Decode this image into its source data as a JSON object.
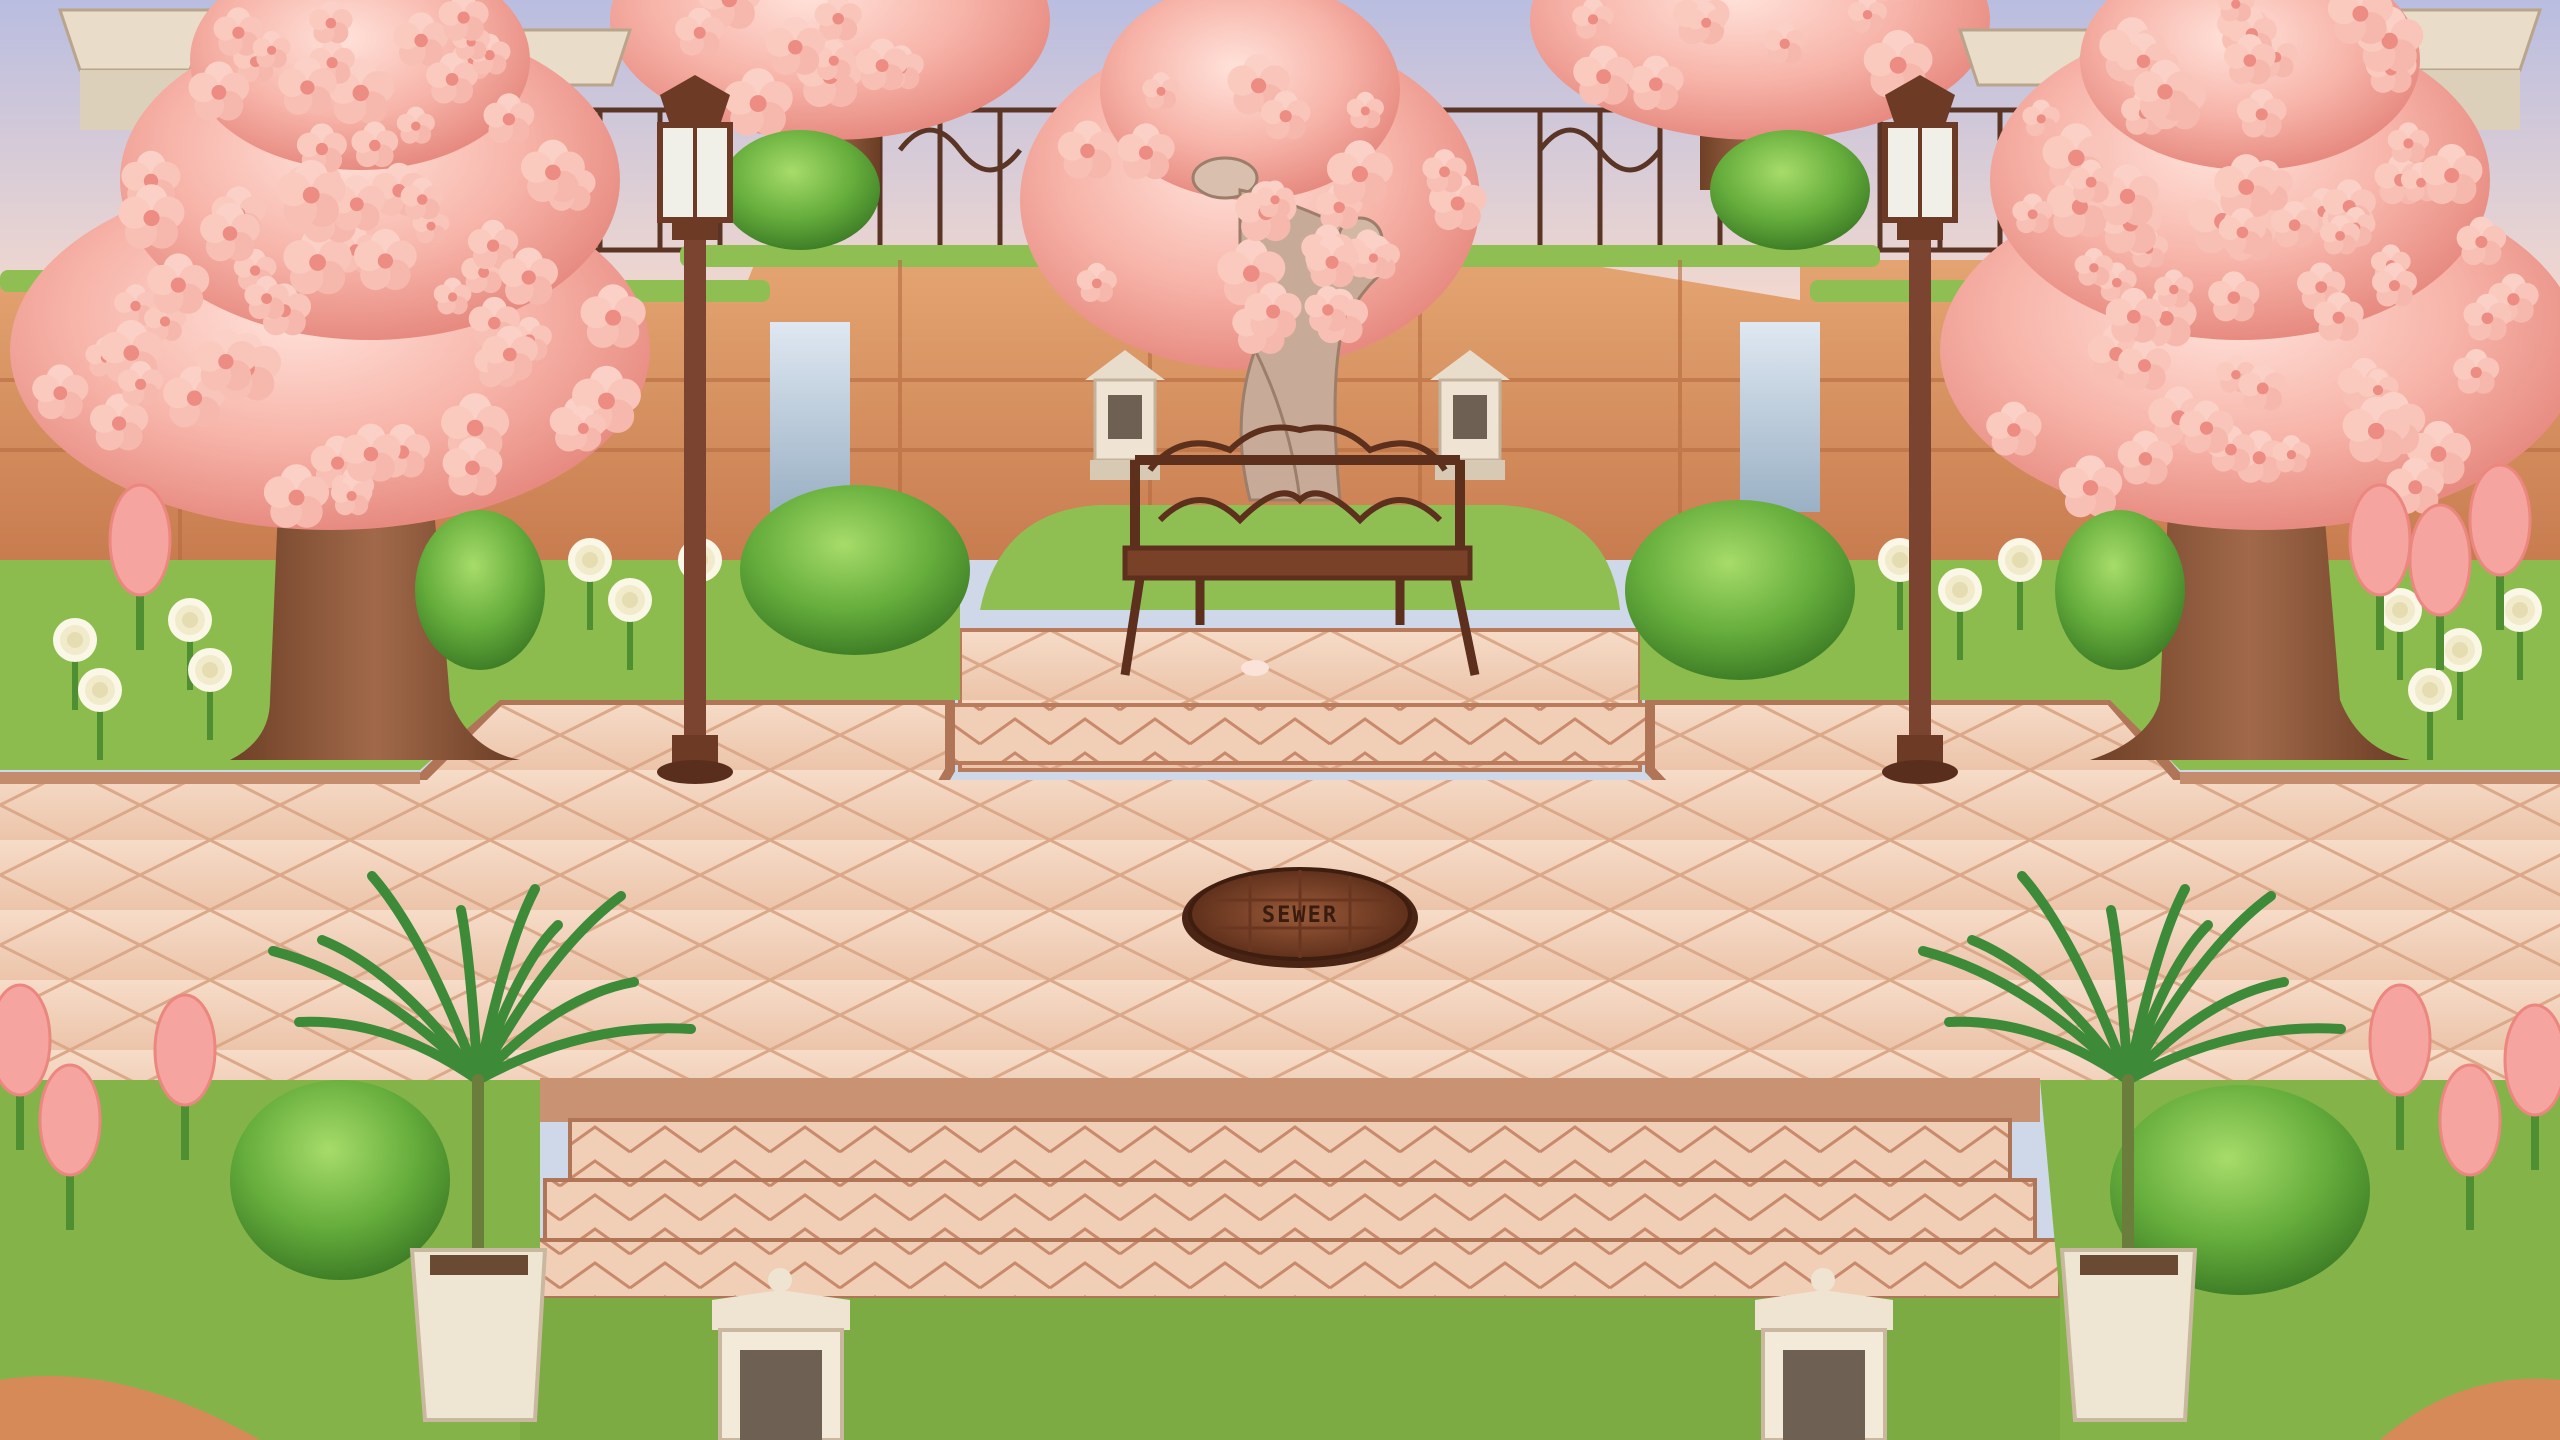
{
  "scene": {
    "manhole_cover_text": "SEWER"
  },
  "colors": {
    "sky": "#cdd2ea",
    "cherry_blossom": "#f7b7ad",
    "cherry_blossom_dark": "#ee8f85",
    "grass": "#86b54a",
    "plaza_tile": "#f2d3bd",
    "plaza_trim": "#c08666",
    "cliff": "#dd9966",
    "bench_iron": "#6d3a26",
    "shrub": "#5ea437",
    "palm_frond": "#3f8a3a",
    "white_rose": "#fbf7e6",
    "hyacinth_pink": "#f6a4a0",
    "statue_stone": "#c7ab98"
  }
}
